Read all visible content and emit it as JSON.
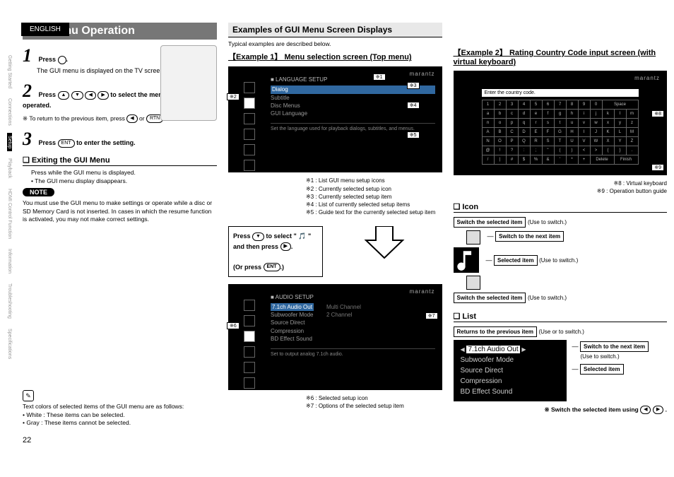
{
  "page": {
    "language": "ENGLISH",
    "number": 22
  },
  "sideTabs": [
    "Getting Started",
    "Connections",
    "Setup",
    "Playback",
    "HDMI Control Function",
    "Information",
    "Troubleshooting",
    "Specifications"
  ],
  "title": "Gui Menu Operation",
  "steps": {
    "s1": {
      "n": "1",
      "bold": "Press ",
      "tail": ".",
      "note": "The GUI menu is displayed on the TV screen."
    },
    "s2": {
      "n": "2",
      "bold_a": "Press ",
      "bold_b": " to select the menu to be set or operated."
    },
    "return": "※ To return to the previous item, press ",
    "return_or": " or ",
    "s3": {
      "n": "3",
      "bold_a": "Press ",
      "bold_b": " to enter the setting."
    }
  },
  "exit": {
    "h": "Exiting the GUI Menu",
    "line": "Press      while the GUI menu is displayed.",
    "bullet": "• The GUI menu display disappears."
  },
  "noteLabel": "NOTE",
  "noteBody": "You must use the GUI menu to make settings or operate while a disc or SD Memory Card is not inserted. In cases in which the resume function is activated, you may not make correct settings.",
  "colors": {
    "intro": "Text colors of selected items of the GUI menu are as follows:",
    "white": "• White : These items can be selected.",
    "gray": "• Gray : These items cannot be selected."
  },
  "examples": {
    "h": "Examples of GUI Menu Screen Displays",
    "intro": "Typical examples are described below."
  },
  "ex1": {
    "h": "【Example 1】 Menu selection screen (Top menu)",
    "brand": "marantz",
    "heading": "■ LANGUAGE SETUP",
    "items": [
      "Dialog",
      "Subtitle",
      "Disc Menus",
      "GUI Language"
    ],
    "guide": "Set the language used for playback dialogs, subtitles, and menus.",
    "callouts": {
      "c1": "※1",
      "c2": "※2",
      "c3": "※3",
      "c4": "※4",
      "c5": "※5",
      "c6": "※6",
      "c7": "※7"
    },
    "legend": [
      "※1 : List GUI menu setup icons",
      "※2 : Currently selected setup icon",
      "※3 : Currently selected setup item",
      "※4 : List of currently selected setup items",
      "※5 : Guide text for the currently selected setup item"
    ],
    "instr_a": "Press ",
    "instr_b": " to select \" ",
    "instr_c": " \" and then press ",
    "instr_d": ".",
    "instr_e": "(Or press ",
    "instr_f": ".)",
    "heading2": "■ AUDIO SETUP",
    "item2_sel": "7.1ch Audio Out",
    "items2": [
      "Subwoofer Mode",
      "Source Direct",
      "Compression",
      "BD Effect Sound"
    ],
    "opts2": [
      "Multi Channel",
      "2 Channel"
    ],
    "guide2": "Set to output analog 7.1ch audio.",
    "legend2": [
      "※6 : Selected setup icon",
      "※7 : Options of the selected setup item"
    ]
  },
  "ex2": {
    "h": "【Example 2】 Rating Country Code input screen (with virtual keyboard)",
    "brand": "marantz",
    "field": "Enter the country code.",
    "callouts": {
      "c8": "※8",
      "c9": "※9"
    },
    "legend": [
      "※8 : Virtual keyboard",
      "※9 : Operation button guide"
    ],
    "kb": {
      "r1": [
        "1",
        "2",
        "3",
        "4",
        "5",
        "6",
        "7",
        "8",
        "9",
        "0",
        "Space"
      ],
      "r2": [
        "a",
        "b",
        "c",
        "d",
        "e",
        "f",
        "g",
        "h",
        "i",
        "j",
        "k",
        "l",
        "m"
      ],
      "r3": [
        "n",
        "o",
        "p",
        "q",
        "r",
        "s",
        "t",
        "u",
        "v",
        "w",
        "x",
        "y",
        "z"
      ],
      "r4": [
        "A",
        "B",
        "C",
        "D",
        "E",
        "F",
        "G",
        "H",
        "I",
        "J",
        "K",
        "L",
        "M"
      ],
      "r5": [
        "N",
        "O",
        "P",
        "Q",
        "R",
        "S",
        "T",
        "U",
        "V",
        "W",
        "X",
        "Y",
        "Z"
      ],
      "r6": [
        "@",
        "!",
        "?",
        ":",
        ";",
        "\"",
        "(",
        ")",
        "<",
        ">",
        "{",
        "}",
        "."
      ],
      "r7": [
        "/",
        "|",
        "#",
        "$",
        "%",
        "&",
        "'",
        "*",
        "+",
        "Delete",
        "Finish"
      ]
    }
  },
  "iconSection": {
    "h": "Icon",
    "lbl_top": "Switch the selected item",
    "use_top": "(Use        to switch.)",
    "lbl_next": "Switch to the next item",
    "lbl_sel": "Selected item",
    "use_sel": "(Use      to switch.)",
    "lbl_bot": "Switch the selected item",
    "use_bot": "(Use        to switch.)"
  },
  "listSection": {
    "h": "List",
    "lbl_ret": "Returns to the previous item",
    "use_ret": "(Use      or       to switch.)",
    "sel": "7.1ch Audio Out",
    "items": [
      "Subwoofer Mode",
      "Source Direct",
      "Compression",
      "BD Effect Sound"
    ],
    "lbl_next": "Switch to the next item",
    "use_next": "(Use      to switch.)",
    "lbl_sel": "Selected item",
    "foot_a": "※ Switch the selected item using ",
    "foot_b": "."
  }
}
